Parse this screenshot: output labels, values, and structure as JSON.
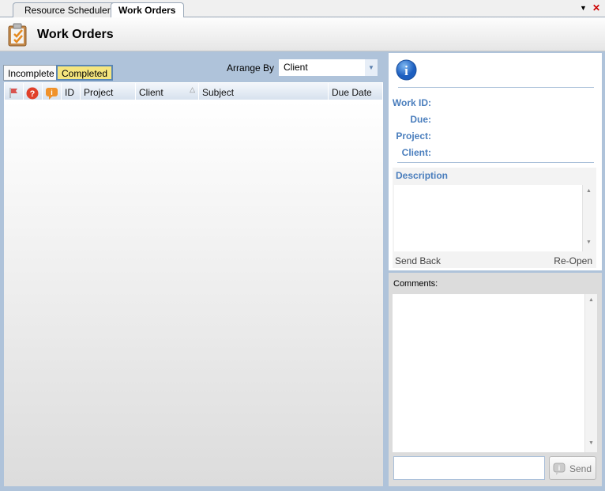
{
  "tabs": [
    {
      "label": "Resource Scheduler",
      "active": false
    },
    {
      "label": "Work Orders",
      "active": true
    }
  ],
  "window_controls": {
    "menu": "▼",
    "close": "✕"
  },
  "header": {
    "title": "Work Orders",
    "icon": "clipboard-check-icon"
  },
  "filters": {
    "incomplete": "Incomplete",
    "completed": "Completed",
    "selected": "Completed"
  },
  "arrange_by": {
    "label": "Arrange By",
    "value": "Client"
  },
  "grid": {
    "columns": [
      "",
      "",
      "",
      "ID",
      "Project",
      "Client",
      "Subject",
      "Due Date"
    ],
    "sorted_column": "Client",
    "sort_indicator": "△",
    "rows": []
  },
  "details": {
    "work_id": "Work ID:",
    "due": "Due:",
    "project": "Project:",
    "client": "Client:",
    "description": "Description",
    "send_back": "Send Back",
    "reopen": "Re-Open"
  },
  "comments": {
    "label": "Comments:",
    "send": "Send"
  },
  "colors": {
    "accent": "#4a7ebd",
    "selected_filter": "#f5e57e",
    "background": "#afc3da"
  }
}
